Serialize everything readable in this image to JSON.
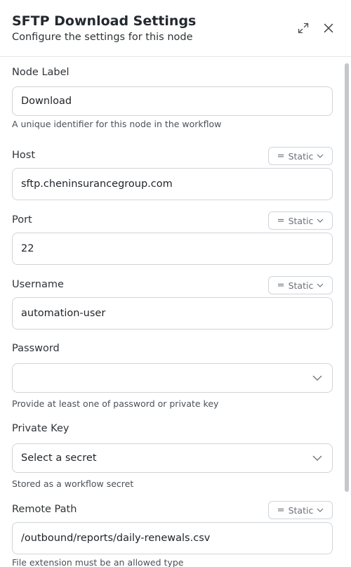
{
  "header": {
    "title": "SFTP Download Settings",
    "subtitle": "Configure the settings for this node"
  },
  "fields": {
    "node_label": {
      "label": "Node Label",
      "value": "Download",
      "help": "A unique identifier for this node in the workflow"
    },
    "host": {
      "label": "Host",
      "value": "sftp.cheninsurancegroup.com",
      "mode": "Static"
    },
    "port": {
      "label": "Port",
      "value": "22",
      "mode": "Static"
    },
    "username": {
      "label": "Username",
      "value": "automation-user",
      "mode": "Static"
    },
    "password": {
      "label": "Password",
      "value": "",
      "help": "Provide at least one of password or private key"
    },
    "private_key": {
      "label": "Private Key",
      "value": "Select a secret",
      "help": "Stored as a workflow secret"
    },
    "remote_path": {
      "label": "Remote Path",
      "value": "/outbound/reports/daily-renewals.csv",
      "mode": "Static",
      "help": "File extension must be an allowed type"
    }
  },
  "icons": {
    "expand": "expand-icon",
    "close": "close-icon",
    "chevron": "chevron-down-icon",
    "equals": "equals-icon"
  }
}
